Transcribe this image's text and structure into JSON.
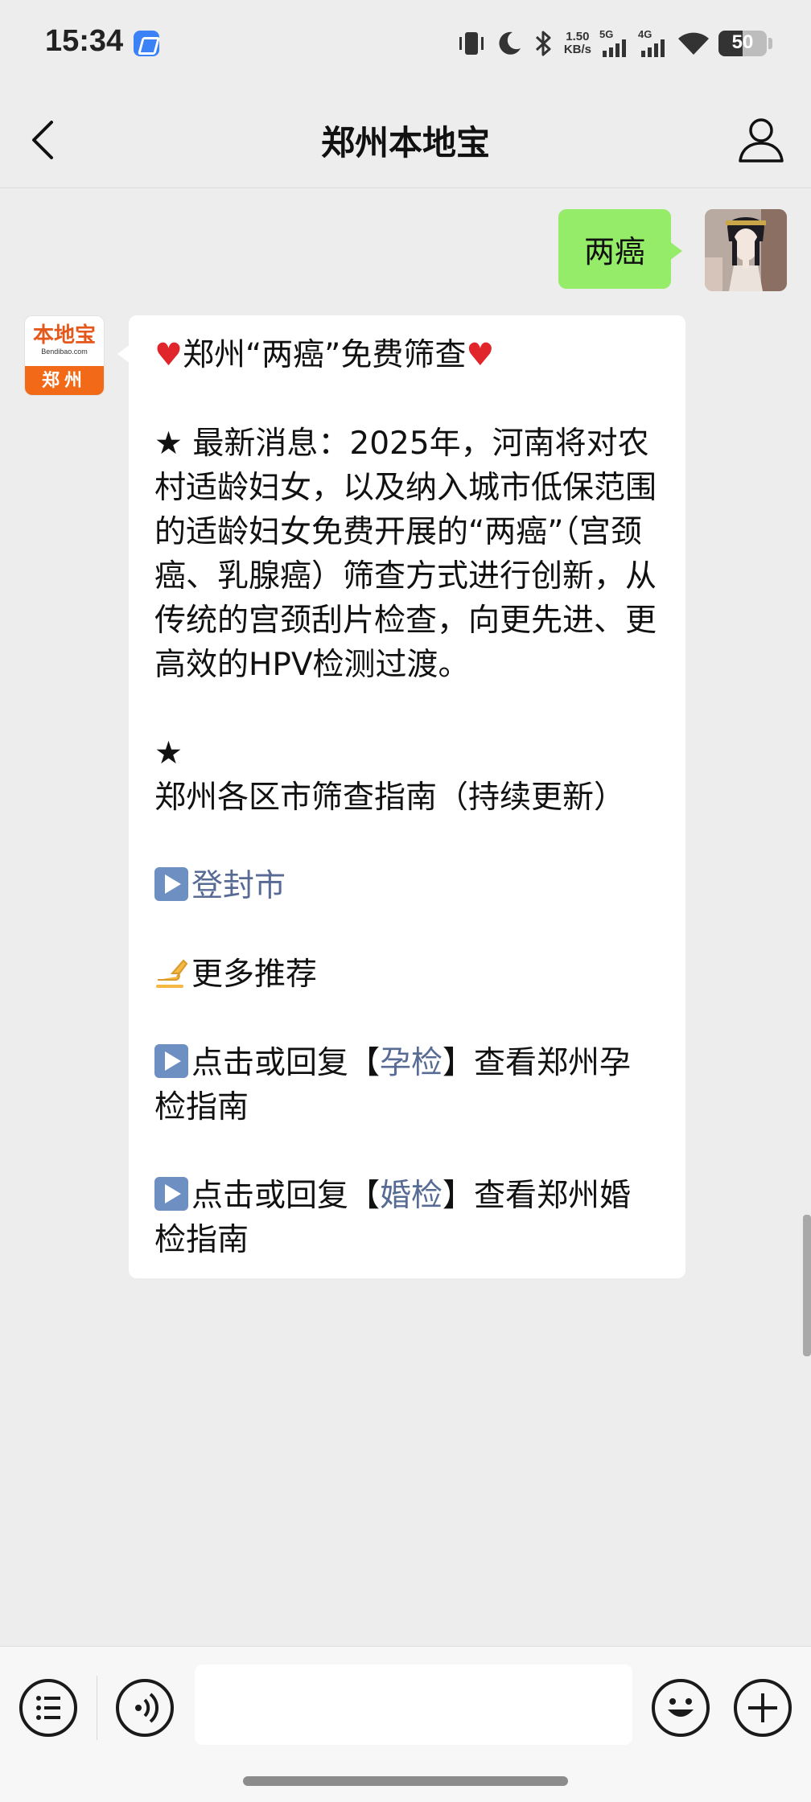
{
  "status_bar": {
    "time": "15:34",
    "net_speed_value": "1.50",
    "net_speed_unit": "KB/s",
    "sim1_label": "5G",
    "sim2_label": "4G",
    "battery": "50",
    "icons": [
      "vibrate-icon",
      "moon-icon",
      "bluetooth-icon",
      "wifi-icon"
    ]
  },
  "header": {
    "title": "郑州本地宝",
    "back_icon": "chevron-left-icon",
    "profile_icon": "person-icon"
  },
  "chat": {
    "outgoing_message": "两癌",
    "bot_avatar": {
      "logo_text": "本地宝",
      "logo_subtext": "Bendibao.com",
      "city_text": "郑州",
      "brand_color": "#f26a17"
    },
    "reply": {
      "heading_text": "郑州“两癌”免费筛查",
      "news_text": "最新消息：2025年，河南将对农村适龄妇女，以及纳入城市低保范围的适龄妇女免费开展的“两癌”（宫颈癌、乳腺癌）筛查方式进行创新，从传统的宫颈刮片检查，向更先进、更高效的HPV检测过渡。",
      "guide_text": "郑州各区市筛查指南（持续更新）",
      "link_dengfeng": "登封市",
      "more_text": "更多推荐",
      "item1_prefix": "点击或回复【",
      "item1_keyword": "孕检",
      "item1_suffix": "】查看郑州孕检指南",
      "item2_prefix": "点击或回复【",
      "item2_keyword": "婚检",
      "item2_suffix": "】查看郑州婚检指南",
      "link_color": "#576b95"
    }
  },
  "input_bar": {
    "placeholder": "",
    "icons": [
      "menu-list-icon",
      "voice-icon",
      "emoji-icon",
      "plus-icon"
    ]
  }
}
